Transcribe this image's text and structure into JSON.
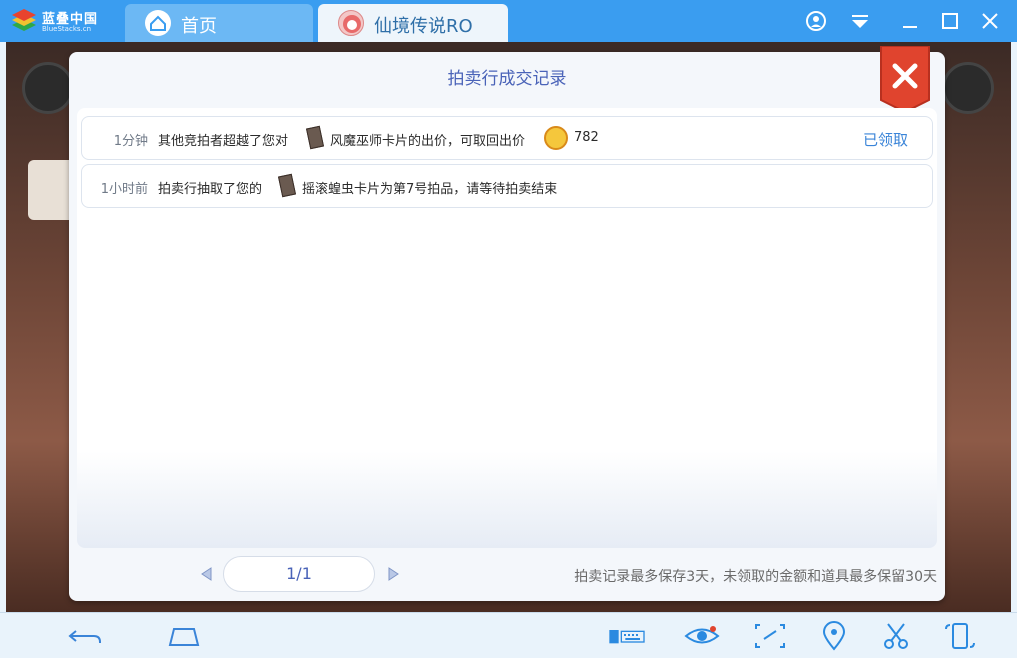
{
  "app": {
    "brand_name": "蓝叠中国",
    "brand_sub": "BlueStacks.cn"
  },
  "tabs": [
    {
      "label": "首页",
      "icon": "home-icon"
    },
    {
      "label": "仙境传说RO",
      "icon": "game-avatar-icon"
    }
  ],
  "dialog": {
    "title": "拍卖行成交记录",
    "records": [
      {
        "time": "1分钟",
        "text_before": "其他竞拍者超越了您对",
        "text_after": "风魔巫师卡片的出价，可取回出价",
        "amount": "782",
        "status": "已领取"
      },
      {
        "time": "1小时前",
        "text_before": "拍卖行抽取了您的",
        "text_after": "摇滚蝗虫卡片为第7号拍品，请等待拍卖结束",
        "amount": "",
        "status": ""
      }
    ],
    "pager": "1/1",
    "footnote": "拍卖记录最多保存3天，未领取的金额和道具最多保留30天"
  },
  "colors": {
    "topbar": "#3a9df0",
    "accent": "#4a63b8",
    "close_red": "#e0442e"
  }
}
